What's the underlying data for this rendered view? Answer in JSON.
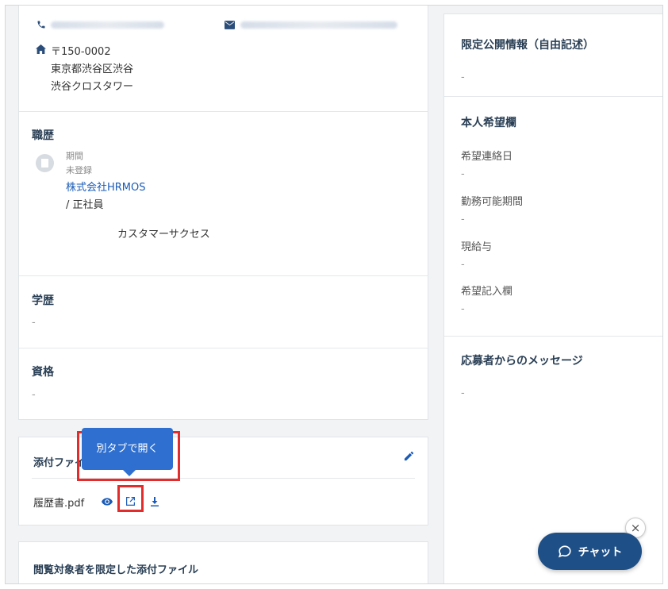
{
  "contact": {
    "postal_code": "〒150-0002",
    "address_line1": "東京都渋谷区渋谷",
    "address_line2": "渋谷クロスタワー"
  },
  "career": {
    "heading": "職歴",
    "period_label": "期間",
    "period_value": "未登録",
    "company": "株式会社HRMOS",
    "employment": "/ 正社員",
    "description": "カスタマーサクセス"
  },
  "education": {
    "heading": "学歴",
    "value": "-"
  },
  "qualifications": {
    "heading": "資格",
    "value": "-"
  },
  "attachments": {
    "heading": "添付ファイ",
    "file_name": "履歴書.pdf",
    "tooltip": "別タブで開く"
  },
  "restricted_attachments": {
    "heading": "閲覧対象者を限定した添付ファイル"
  },
  "limited_info": {
    "heading": "限定公開情報（自由記述）",
    "value": "-"
  },
  "preferences": {
    "heading": "本人希望欄",
    "items": [
      {
        "label": "希望連絡日",
        "value": "-"
      },
      {
        "label": "勤務可能期間",
        "value": "-"
      },
      {
        "label": "現給与",
        "value": "-"
      },
      {
        "label": "希望記入欄",
        "value": "-"
      }
    ]
  },
  "applicant_message": {
    "heading": "応募者からのメッセージ",
    "value": "-"
  },
  "chat": {
    "label": "チャット",
    "close": "×"
  },
  "colors": {
    "accent": "#1a5bb7",
    "highlight": "#e32c2c",
    "chat_bg": "#1e4f86"
  }
}
